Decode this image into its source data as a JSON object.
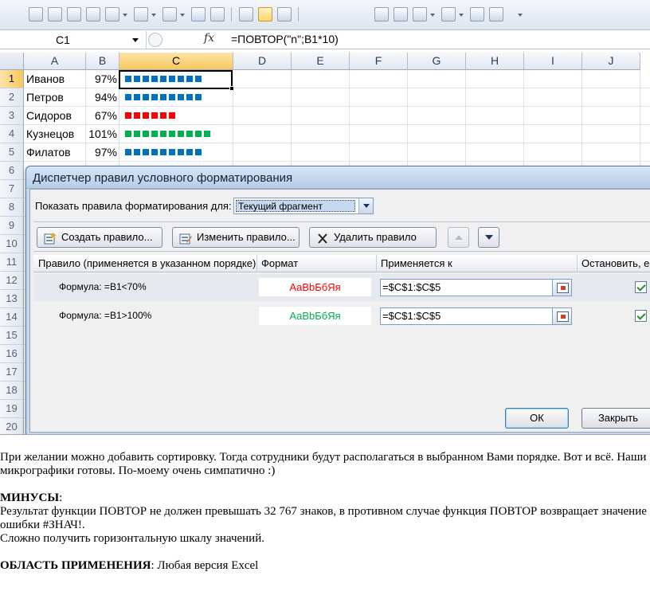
{
  "formula_bar": {
    "name_box": "C1",
    "fx_label": "fx",
    "formula": "=ПОВТОР(\"n\";B1*10)"
  },
  "sheet": {
    "columns": [
      "A",
      "B",
      "C",
      "D",
      "E",
      "F",
      "G",
      "H",
      "I",
      "J"
    ],
    "rows": [
      "1",
      "2",
      "3",
      "4",
      "5",
      "6",
      "7",
      "8",
      "9",
      "10",
      "11",
      "12",
      "13",
      "14",
      "15",
      "16",
      "17",
      "18",
      "19",
      "20"
    ],
    "data": [
      {
        "name": "Иванов",
        "pct": "97%",
        "squares": 9,
        "color": "#0070c0"
      },
      {
        "name": "Петров",
        "pct": "94%",
        "squares": 9,
        "color": "#0070c0"
      },
      {
        "name": "Сидоров",
        "pct": "67%",
        "squares": 6,
        "color": "#ff0000"
      },
      {
        "name": "Кузнецов",
        "pct": "101%",
        "squares": 10,
        "color": "#00b050"
      },
      {
        "name": "Филатов",
        "pct": "97%",
        "squares": 9,
        "color": "#0070c0"
      }
    ]
  },
  "dialog": {
    "title": "Диспетчер правил условного форматирования",
    "show_label": "Показать правила форматирования для:",
    "scope_value": "Текущий фрагмент",
    "buttons": {
      "new_rule": "Создать правило...",
      "edit_rule": "Изменить правило...",
      "delete_rule": "Удалить правило"
    },
    "columns": {
      "rule": "Правило (применяется в указанном порядке)",
      "format": "Формат",
      "applies_to": "Применяется к",
      "stop": "Остановить, е"
    },
    "rules": [
      {
        "formula": "Формула: =B1<70%",
        "preview": "АаВbБбЯя",
        "preview_color": "#ff0000",
        "applies_to": "=$C$1:$C$5"
      },
      {
        "formula": "Формула: =B1>100%",
        "preview": "АаВbБбЯя",
        "preview_color": "#00b050",
        "applies_to": "=$C$1:$C$5"
      }
    ],
    "ok": "ОК",
    "close": "Закрыть"
  },
  "text": {
    "p1": "При желании можно добавить сортировку. Тогда сотрудники будут располагаться в выбранном Вами порядке. Вот и всё. Наши микрографики готовы. По-моему очень симпатично :)",
    "minus_heading": "МИНУСЫ",
    "minus_colon": ":",
    "minus_1": "Результат функции ПОВТОР не должен превышать 32 767 знаков, в противном случае функция ПОВТОР возвращает значение ошибки #ЗНАЧ!.",
    "minus_2": "Сложно получить горизонтальную шкалу значений.",
    "scope_heading": "ОБЛАСТЬ ПРИМЕНЕНИЯ",
    "scope_text": ": Любая версия Excel"
  }
}
